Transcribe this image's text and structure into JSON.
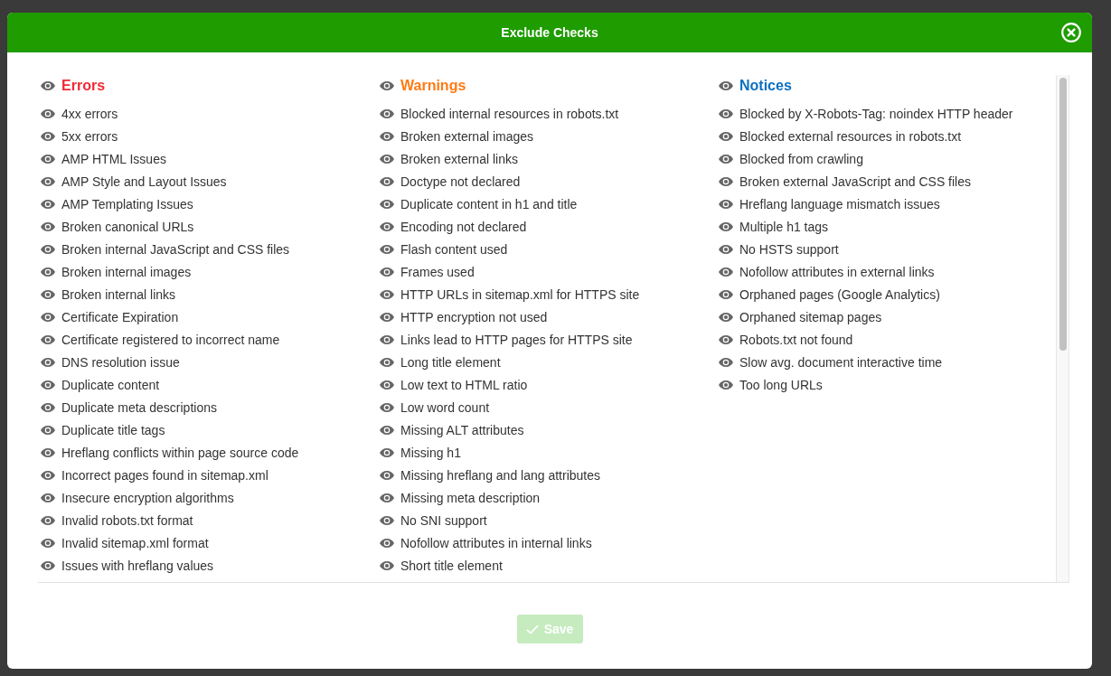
{
  "dialog": {
    "title": "Exclude Checks",
    "groups": [
      {
        "title": "Errors",
        "color": "#ee2b35",
        "checks": [
          "4xx errors",
          "5xx errors",
          "AMP HTML Issues",
          "AMP Style and Layout Issues",
          "AMP Templating Issues",
          "Broken canonical URLs",
          "Broken internal JavaScript and CSS files",
          "Broken internal images",
          "Broken internal links",
          "Certificate Expiration",
          "Certificate registered to incorrect name",
          "DNS resolution issue",
          "Duplicate content",
          "Duplicate meta descriptions",
          "Duplicate title tags",
          "Hreflang conflicts within page source code",
          "Incorrect pages found in sitemap.xml",
          "Insecure encryption algorithms",
          "Invalid robots.txt format",
          "Invalid sitemap.xml format",
          "Issues with hreflang values"
        ]
      },
      {
        "title": "Warnings",
        "color": "#ff7a12",
        "checks": [
          "Blocked internal resources in robots.txt",
          "Broken external images",
          "Broken external links",
          "Doctype not declared",
          "Duplicate content in h1 and title",
          "Encoding not declared",
          "Flash content used",
          "Frames used",
          "HTTP URLs in sitemap.xml for HTTPS site",
          "HTTP encryption not used",
          "Links lead to HTTP pages for HTTPS site",
          "Long title element",
          "Low text to HTML ratio",
          "Low word count",
          "Missing ALT attributes",
          "Missing h1",
          "Missing hreflang and lang attributes",
          "Missing meta description",
          "No SNI support",
          "Nofollow attributes in internal links",
          "Short title element"
        ]
      },
      {
        "title": "Notices",
        "color": "#0b6fc0",
        "checks": [
          "Blocked by X-Robots-Tag: noindex HTTP header",
          "Blocked external resources in robots.txt",
          "Blocked from crawling",
          "Broken external JavaScript and CSS files",
          "Hreflang language mismatch issues",
          "Multiple h1 tags",
          "No HSTS support",
          "Nofollow attributes in external links",
          "Orphaned pages (Google Analytics)",
          "Orphaned sitemap pages",
          "Robots.txt not found",
          "Slow avg. document interactive time",
          "Too long URLs"
        ]
      }
    ],
    "save_button": {
      "label": "Save",
      "disabled": true
    }
  }
}
